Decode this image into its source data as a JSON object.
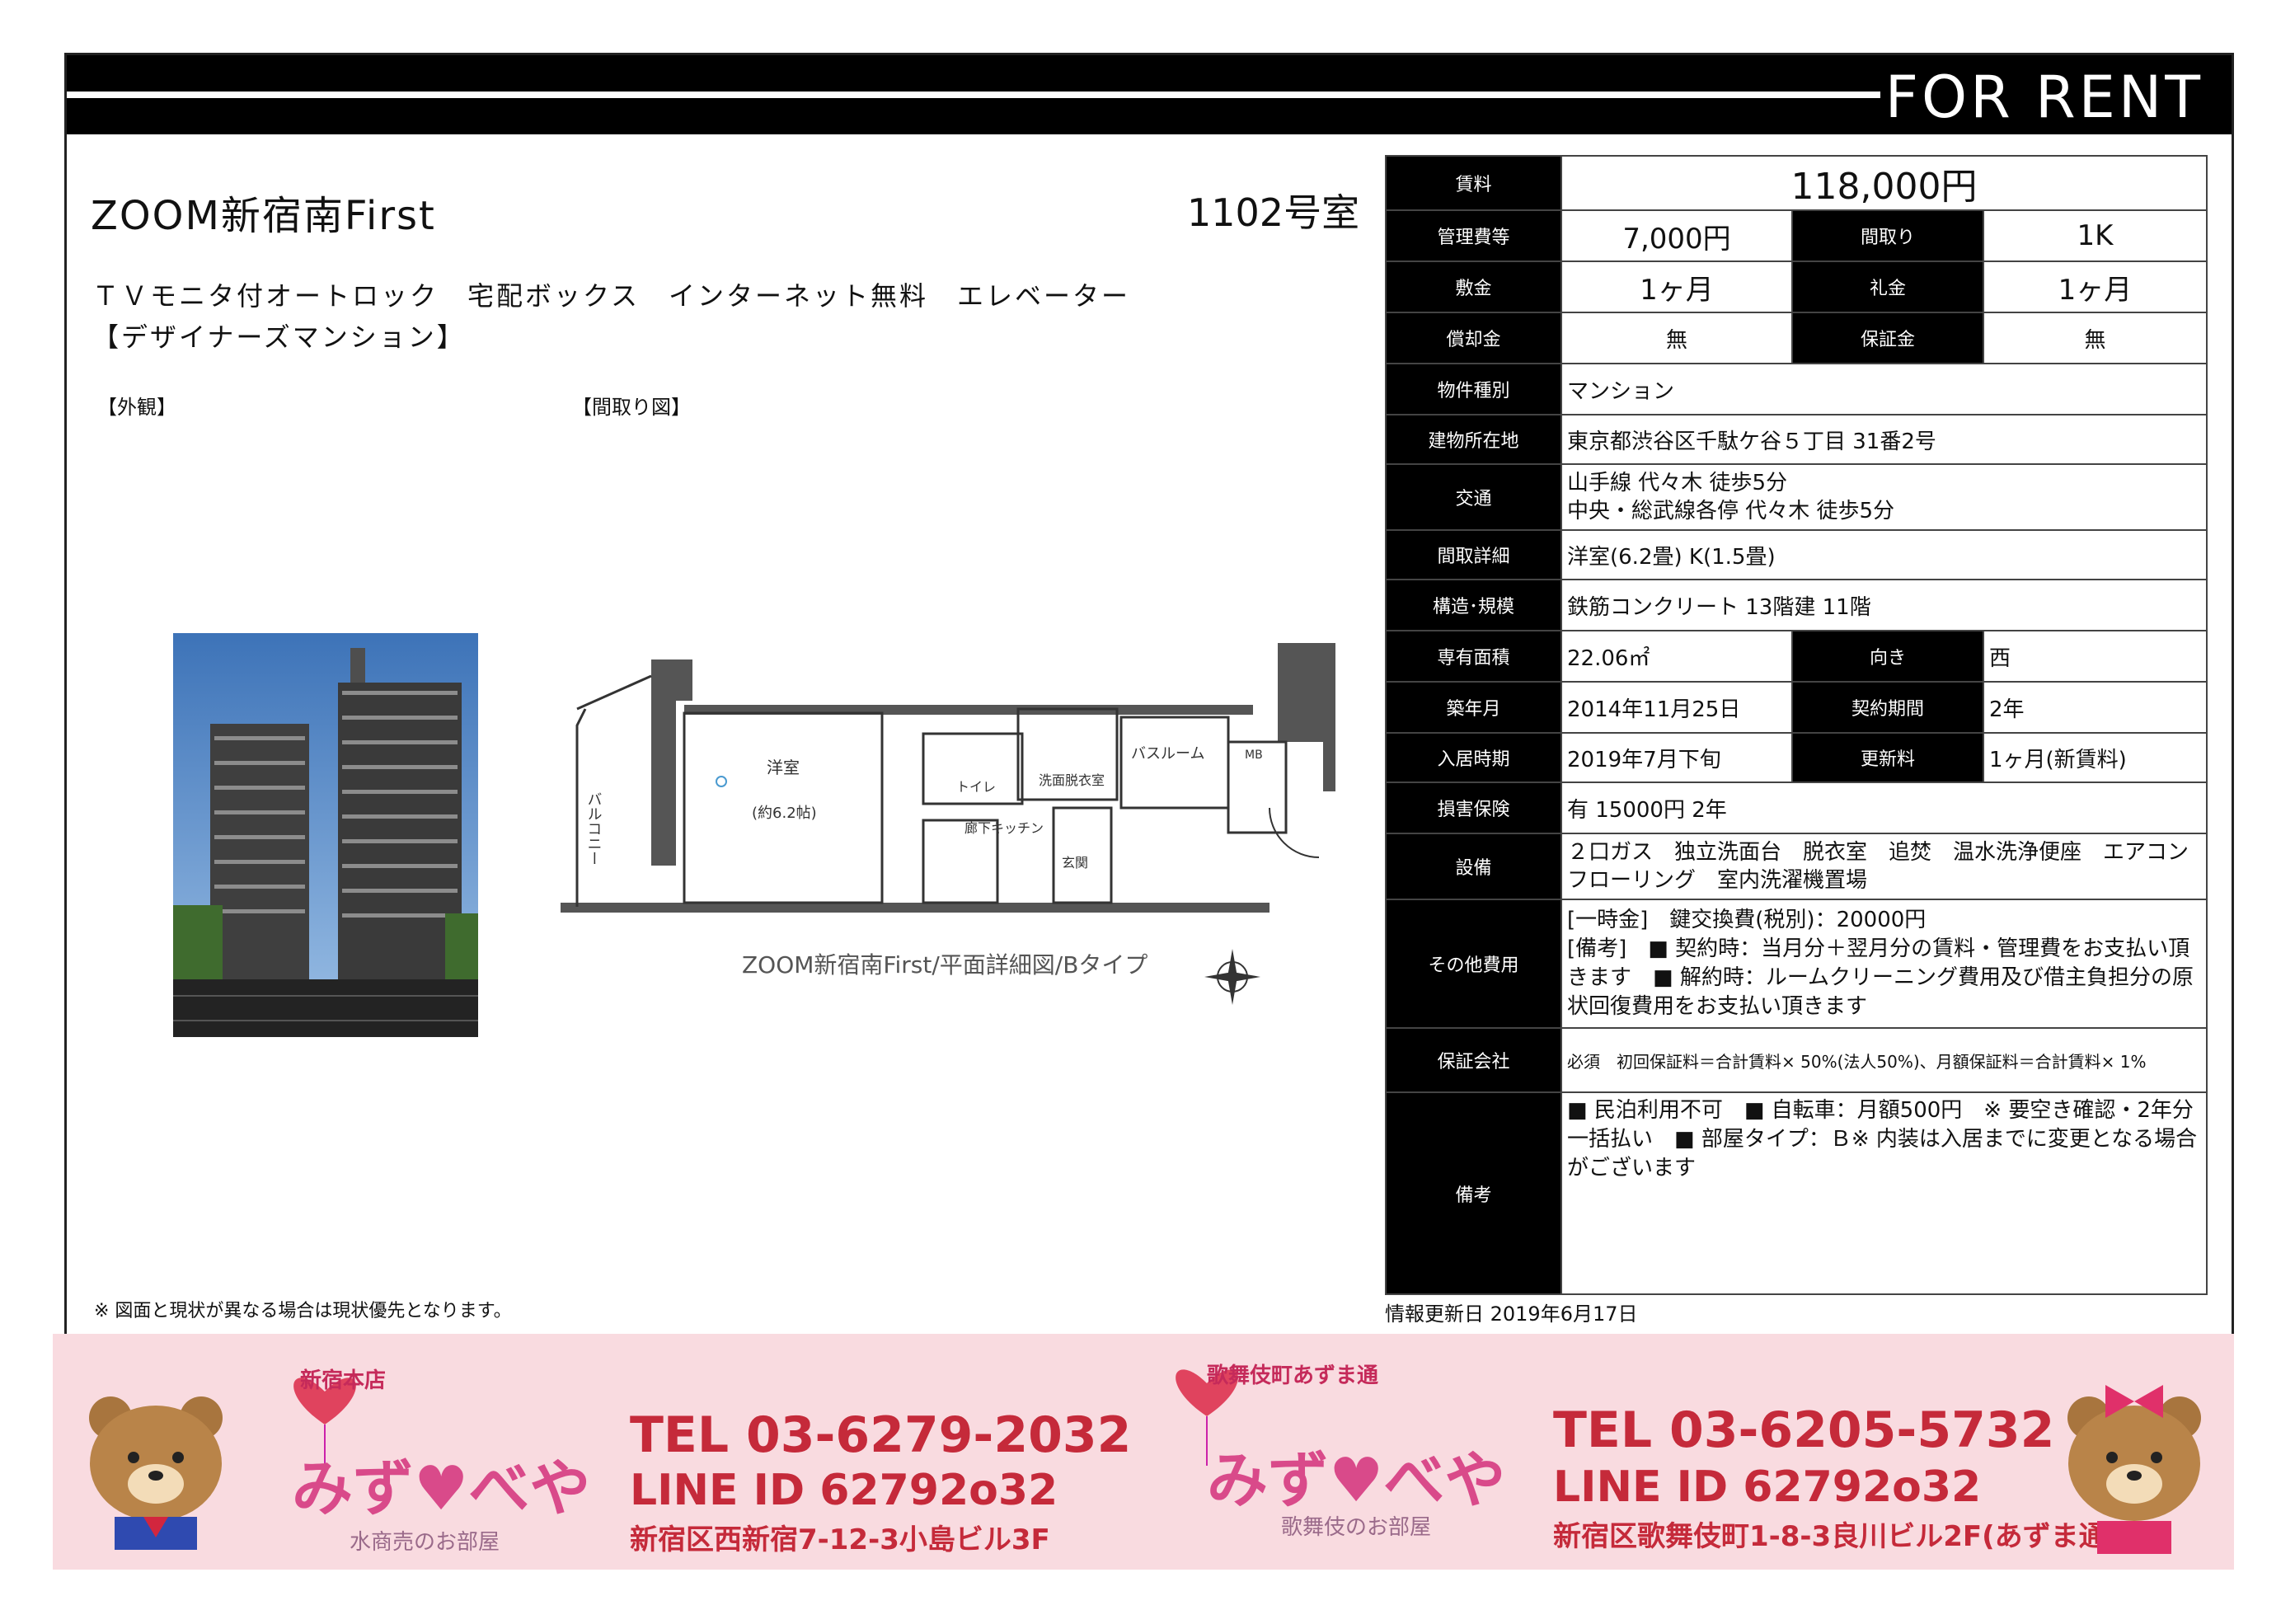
{
  "header": {
    "for_rent": "FOR RENT"
  },
  "property": {
    "name": "ZOOM新宿南First",
    "room": "1102号室",
    "features_line1": "ＴＶモニタ付オートロック　宅配ボックス　インターネット無料　エレベーター",
    "features_line2": "【デザイナーズマンション】",
    "label_exterior": "【外観】",
    "label_floorplan": "【間取り図】",
    "floorplan_caption": "ZOOM新宿南First/平面詳細図/Bタイプ",
    "plan_labels": {
      "balcony": "バルコニー",
      "room": "洋室",
      "room_size": "(約6.2帖)",
      "toilet": "トイレ",
      "washroom": "洗面脱衣室",
      "bath": "バスルーム",
      "hallway_kitchen": "廊下キッチン",
      "entrance": "玄関",
      "mb": "MB"
    },
    "note": "※ 図面と現状が異なる場合は現状優先となります。"
  },
  "spec": {
    "rent_label": "賃料",
    "rent": "118,000円",
    "mgmt_label": "管理費等",
    "mgmt": "7,000円",
    "layout_label": "間取り",
    "layout": "1K",
    "deposit_label": "敷金",
    "deposit": "1ヶ月",
    "keymoney_label": "礼金",
    "keymoney": "1ヶ月",
    "amort_label": "償却金",
    "amort": "無",
    "guarantee_label": "保証金",
    "guarantee": "無",
    "type_label": "物件種別",
    "type": "マンション",
    "address_label": "建物所在地",
    "address": "東京都渋谷区千駄ケ谷５丁目 31番2号",
    "transit_label": "交通",
    "transit1": "山手線 代々木 徒歩5分",
    "transit2": "中央・総武線各停 代々木 徒歩5分",
    "detail_label": "間取詳細",
    "detail": "洋室(6.2畳) K(1.5畳)",
    "structure_label": "構造･規模",
    "structure": "鉄筋コンクリート 13階建 11階",
    "area_label": "専有面積",
    "area": "22.06㎡",
    "direction_label": "向き",
    "direction": "西",
    "built_label": "築年月",
    "built": "2014年11月25日",
    "contract_label": "契約期間",
    "contract": "2年",
    "movein_label": "入居時期",
    "movein": "2019年7月下旬",
    "renew_label": "更新料",
    "renew": "1ヶ月(新賃料)",
    "insurance_label": "損害保険",
    "insurance": "有  15000円 2年",
    "equipment_label": "設備",
    "equipment": "２口ガス　独立洗面台　脱衣室　追焚　温水洗浄便座　エアコン　フローリング　室内洗濯機置場",
    "other_label": "その他費用",
    "other1": "[一時金]　鍵交換費(税別)：20000円",
    "other2": "[備考]　■ 契約時：当月分＋翌月分の賃料・管理費をお支払い頂きます　■ 解約時：ルームクリーニング費用及び借主負担分の原状回復費用をお支払い頂きます",
    "guarantor_label": "保証会社",
    "guarantor": "必須　初回保証料＝合計賃料× 50%(法人50%)、月額保証料＝合計賃料× 1%",
    "remarks_label": "備考",
    "remarks": "■ 民泊利用不可　■ 自転車：月額500円　※ 要空き確認・2年分一括払い　■ 部屋タイプ：Ｂ※ 内装は入居までに変更となる場合がございます"
  },
  "updated": "情報更新日 2019年6月17日",
  "banner": {
    "store1_tag": "新宿本店",
    "store1_logo": "みず♥べや",
    "store1_sub": "水商売のお部屋",
    "store1_tel": "TEL 03-6279-2032",
    "store1_line": "LINE ID 62792o32",
    "store1_addr": "新宿区西新宿7-12-3小島ビル3F",
    "store2_tag": "歌舞伎町あずま通",
    "store2_logo": "みず♥べや",
    "store2_sub": "歌舞伎のお部屋",
    "store2_tel": "TEL 03-6205-5732",
    "store2_line": "LINE ID 62792o32",
    "store2_addr": "新宿区歌舞伎町1-8-3良川ビル2F(あずま通り)",
    "accent": "#c52a3a"
  }
}
